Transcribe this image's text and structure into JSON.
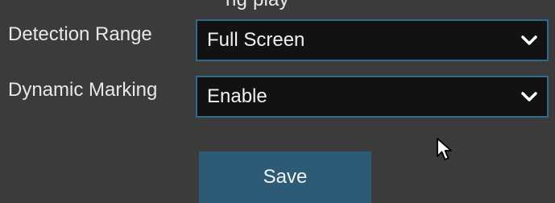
{
  "window": {
    "title_partial": "ng   play"
  },
  "fields": [
    {
      "label": "Detection Range",
      "value": "Full Screen",
      "dropdown_icon": "chevron-down-icon"
    },
    {
      "label": "Dynamic Marking",
      "value": "Enable",
      "dropdown_icon": "chevron-down-icon"
    }
  ],
  "actions": {
    "save_label": "Save"
  },
  "cursor": {
    "icon": "mouse-pointer-icon"
  },
  "colors": {
    "background": "#3b3b3b",
    "select_bg": "#121212",
    "select_border": "#2f6a8a",
    "button_bg": "#2d5b75",
    "text": "#e8e8e8"
  }
}
